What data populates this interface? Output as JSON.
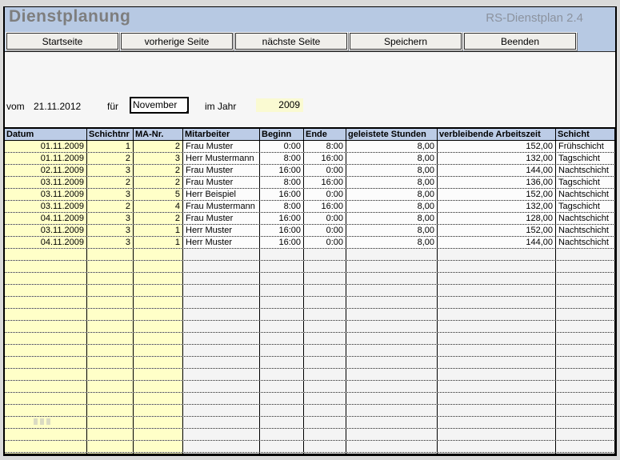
{
  "app": {
    "title": "Dienstplanung",
    "version_label": "RS-Dienstplan 2.4"
  },
  "toolbar": {
    "buttons": [
      "Startseite",
      "vorherige Seite",
      "nächste Seite",
      "Speichern",
      "Beenden"
    ]
  },
  "filter": {
    "vom_label": "vom",
    "vom_value": "21.11.2012",
    "fuer_label": "für",
    "month_value": "November",
    "im_jahr_label": "im Jahr",
    "year_value": "2009"
  },
  "table": {
    "headers": [
      "Datum",
      "Schichtnr",
      "MA-Nr.",
      "Mitarbeiter",
      "Beginn",
      "Ende",
      "geleistete Stunden",
      "verbleibende Arbeitszeit",
      "Schicht"
    ],
    "rows": [
      [
        "01.11.2009",
        "1",
        "2",
        "Frau Muster",
        "0:00",
        "8:00",
        "8,00",
        "152,00",
        "Frühschicht"
      ],
      [
        "01.11.2009",
        "2",
        "3",
        "Herr Mustermann",
        "8:00",
        "16:00",
        "8,00",
        "132,00",
        "Tagschicht"
      ],
      [
        "02.11.2009",
        "3",
        "2",
        "Frau Muster",
        "16:00",
        "0:00",
        "8,00",
        "144,00",
        "Nachtschicht"
      ],
      [
        "03.11.2009",
        "2",
        "2",
        "Frau Muster",
        "8:00",
        "16:00",
        "8,00",
        "136,00",
        "Tagschicht"
      ],
      [
        "03.11.2009",
        "3",
        "5",
        "Herr Beispiel",
        "16:00",
        "0:00",
        "8,00",
        "152,00",
        "Nachtschicht"
      ],
      [
        "03.11.2009",
        "2",
        "4",
        "Frau Mustermann",
        "8:00",
        "16:00",
        "8,00",
        "132,00",
        "Tagschicht"
      ],
      [
        "04.11.2009",
        "3",
        "2",
        "Frau Muster",
        "16:00",
        "0:00",
        "8,00",
        "128,00",
        "Nachtschicht"
      ],
      [
        "03.11.2009",
        "3",
        "1",
        "Herr Muster",
        "16:00",
        "0:00",
        "8,00",
        "152,00",
        "Nachtschicht"
      ],
      [
        "04.11.2009",
        "3",
        "1",
        "Herr Muster",
        "16:00",
        "0:00",
        "8,00",
        "144,00",
        "Nachtschicht"
      ]
    ],
    "empty_row_count": 18
  },
  "colors": {
    "banner_blue": "#B7C9E3",
    "table_header_blue": "#BCCCE6",
    "cell_yellow": "#FFFFC8",
    "year_cell_yellow": "#FAFAD2",
    "title_gray": "#7E7E7E"
  }
}
